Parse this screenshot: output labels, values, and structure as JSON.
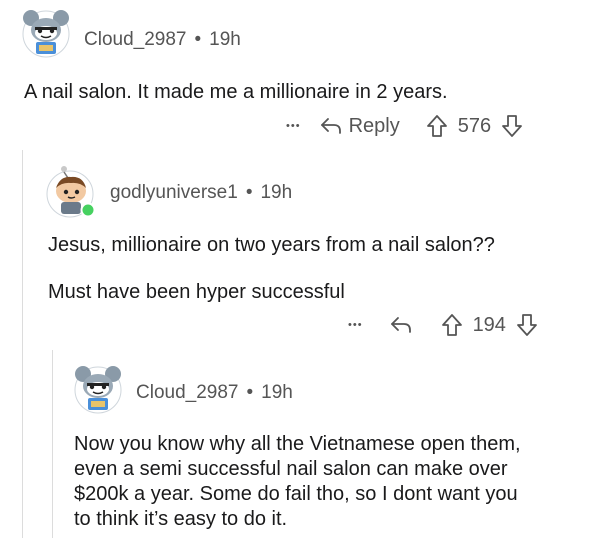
{
  "comments": [
    {
      "username": "Cloud_2987",
      "separator": "•",
      "time": "19h",
      "body": [
        "A nail salon. It made me a millionaire in 2 years."
      ],
      "actions": {
        "more": "•••",
        "reply": "Reply",
        "score": "576"
      }
    },
    {
      "username": "godlyuniverse1",
      "separator": "•",
      "time": "19h",
      "body": [
        "Jesus,  millionaire on two years from a nail salon??",
        "Must have been hyper successful"
      ],
      "actions": {
        "more": "•••",
        "score": "194"
      }
    },
    {
      "username": "Cloud_2987",
      "separator": "•",
      "time": "19h",
      "body": [
        "Now you know why all the Vietnamese open them,",
        "even a semi successful nail salon can make over",
        "$200k a year.  Some do fail tho, so I dont want you",
        "to think it’s easy to do it."
      ]
    }
  ],
  "colors": {
    "online": "#46d160",
    "meta": "#555555",
    "text": "#1a1a1b"
  }
}
